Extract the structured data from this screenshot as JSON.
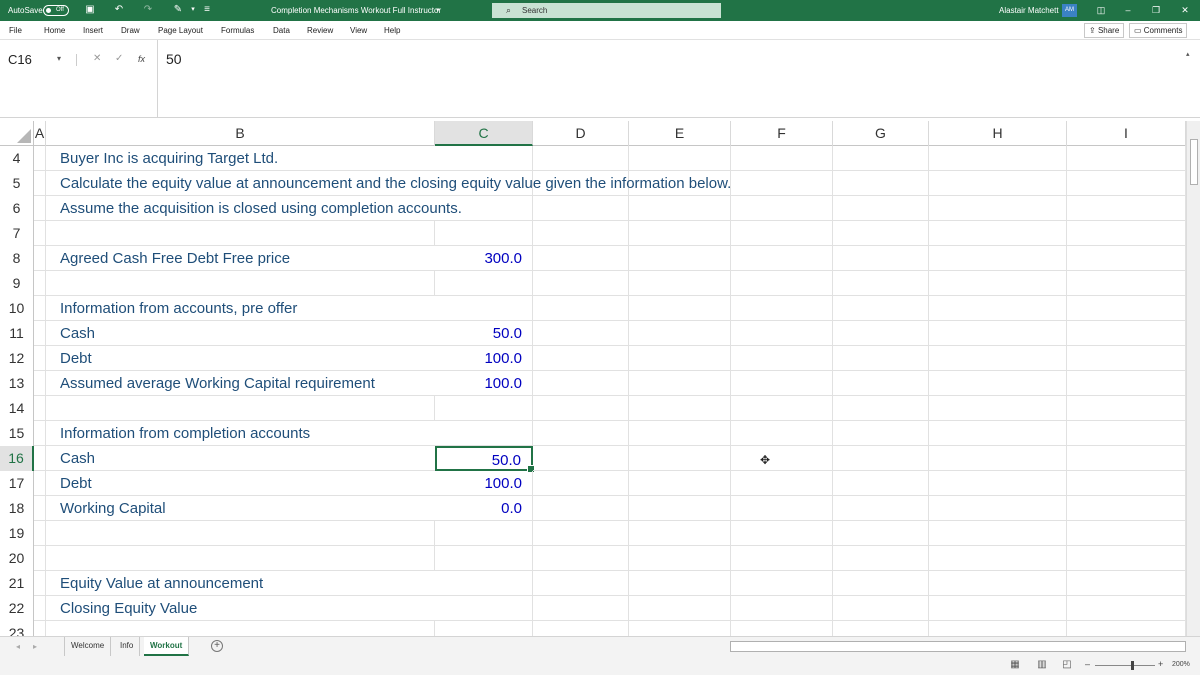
{
  "titlebar": {
    "autosave_label": "AutoSave",
    "autosave_state": "Off",
    "document_title": "Completion Mechanisms Workout Full Instructor",
    "title_dropdown": "▾",
    "search_placeholder": "Search",
    "user_name": "Alastair Matchett",
    "user_initials": "AM",
    "accent_color": "#217346"
  },
  "menu": {
    "items": [
      "File",
      "Home",
      "Insert",
      "Draw",
      "Page Layout",
      "Formulas",
      "Data",
      "Review",
      "View",
      "Help"
    ],
    "share_label": "Share",
    "comments_label": "Comments"
  },
  "formula_bar": {
    "name_box": "C16",
    "fx_label": "fx",
    "value": "50"
  },
  "columns": [
    "A",
    "B",
    "C",
    "D",
    "E",
    "F",
    "G",
    "H",
    "I"
  ],
  "active_column": "C",
  "rows": [
    {
      "num": "4",
      "b": "Buyer Inc is acquiring Target Ltd.",
      "c": ""
    },
    {
      "num": "5",
      "b": "Calculate the equity value at announcement and the closing equity value given the information below.",
      "c": ""
    },
    {
      "num": "6",
      "b": "Assume the acquisition is closed using completion accounts.",
      "c": ""
    },
    {
      "num": "7",
      "b": "",
      "c": ""
    },
    {
      "num": "8",
      "b": "Agreed Cash Free Debt Free price",
      "c": "300.0"
    },
    {
      "num": "9",
      "b": "",
      "c": ""
    },
    {
      "num": "10",
      "b": "Information from accounts, pre offer",
      "c": ""
    },
    {
      "num": "11",
      "b": "Cash",
      "c": "50.0"
    },
    {
      "num": "12",
      "b": "Debt",
      "c": "100.0"
    },
    {
      "num": "13",
      "b": "Assumed average Working Capital requirement",
      "c": "100.0"
    },
    {
      "num": "14",
      "b": "",
      "c": ""
    },
    {
      "num": "15",
      "b": "Information from completion accounts",
      "c": ""
    },
    {
      "num": "16",
      "b": "Cash",
      "c": "50.0"
    },
    {
      "num": "17",
      "b": "Debt",
      "c": "100.0"
    },
    {
      "num": "18",
      "b": "Working Capital",
      "c": "0.0"
    },
    {
      "num": "19",
      "b": "",
      "c": ""
    },
    {
      "num": "20",
      "b": "",
      "c": ""
    },
    {
      "num": "21",
      "b": "Equity Value at announcement",
      "c": ""
    },
    {
      "num": "22",
      "b": "Closing Equity Value",
      "c": ""
    },
    {
      "num": "23",
      "b": "",
      "c": ""
    }
  ],
  "active_row": "16",
  "sheets": {
    "tabs": [
      "Welcome",
      "Info",
      "Workout"
    ],
    "active": "Workout"
  },
  "status": {
    "zoom": "200%"
  }
}
